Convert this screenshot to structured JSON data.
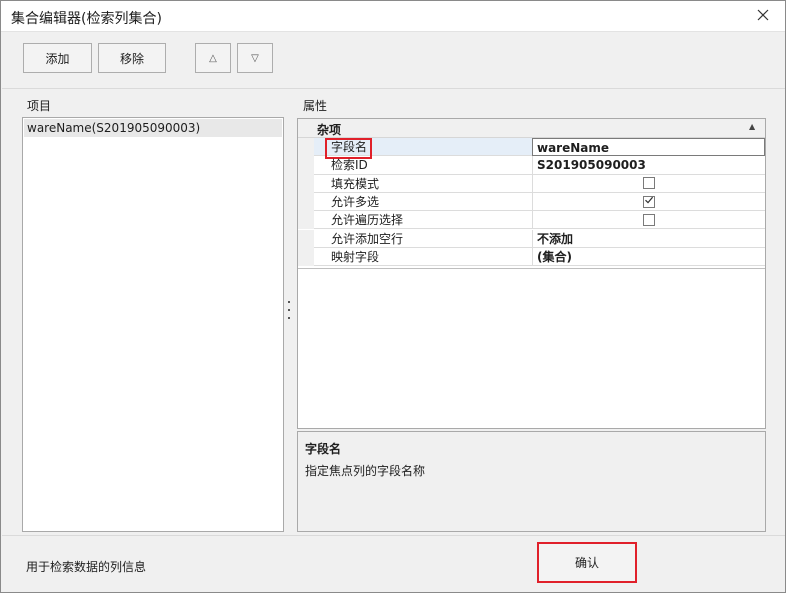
{
  "window": {
    "title": "集合编辑器(检索列集合)",
    "close_symbol": "✕"
  },
  "toolbar": {
    "add_label": "添加",
    "remove_label": "移除",
    "move_up_symbol": "△",
    "move_down_symbol": "▽"
  },
  "left_panel": {
    "header": "项目",
    "items": [
      {
        "label": "wareName(S201905090003)",
        "selected": true
      }
    ]
  },
  "right_panel": {
    "header": "属性",
    "category": "杂项",
    "collapse_symbol": "▲",
    "properties": [
      {
        "name": "字段名",
        "value": "wareName",
        "bold": true,
        "selected": true,
        "editing": true
      },
      {
        "name": "检索ID",
        "value": "S201905090003",
        "bold": true
      },
      {
        "name": "填充模式",
        "checkbox": true,
        "checked": false
      },
      {
        "name": "允许多选",
        "checkbox": true,
        "checked": true
      },
      {
        "name": "允许遍历选择",
        "checkbox": true,
        "checked": false
      },
      {
        "name": "允许添加空行",
        "value": "不添加",
        "bold": true
      },
      {
        "name": "映射字段",
        "value": "(集合)",
        "bold": true
      }
    ],
    "description": {
      "title": "字段名",
      "text": "指定焦点列的字段名称"
    }
  },
  "footer": {
    "info_text": "用于检索数据的列信息",
    "ok_label": "确认"
  },
  "colors": {
    "highlight": "#e0202a",
    "selection": "#e5eef8",
    "window_bg": "#f0f0f0"
  }
}
